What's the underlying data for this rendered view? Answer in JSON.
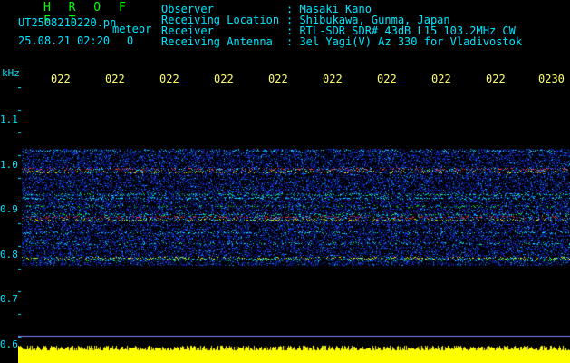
{
  "header": {
    "title": "H R O F F T",
    "filename": "UT2508210220.pn",
    "tag": "meteor",
    "datetime": "25.08.21 02:20",
    "count": "0",
    "info": [
      {
        "label": "Observer",
        "value": ": Masaki Kano"
      },
      {
        "label": "Receiving Location",
        "value": ": Shibukawa, Gunma, Japan"
      },
      {
        "label": "Receiver",
        "value": ": RTL-SDR SDR# 43dB L15 103.2MHz CW"
      },
      {
        "label": "Receiving Antenna",
        "value": ": 3el Yagi(V) Az 330 for Vladivostok"
      }
    ]
  },
  "axis": {
    "unit": "kHz",
    "y_ticks": [
      "1.1",
      "1.0",
      "0.9",
      "0.8",
      "0.7",
      "0.6"
    ],
    "time_ticks": [
      "022",
      "022",
      "022",
      "022",
      "022",
      "022",
      "022",
      "022",
      "022",
      "0230"
    ]
  },
  "colors": {
    "background": "#000000",
    "text": "#00e5ff",
    "title": "#00ff00",
    "ticks": "#ffff66",
    "signal_level": "#ffff00"
  }
}
